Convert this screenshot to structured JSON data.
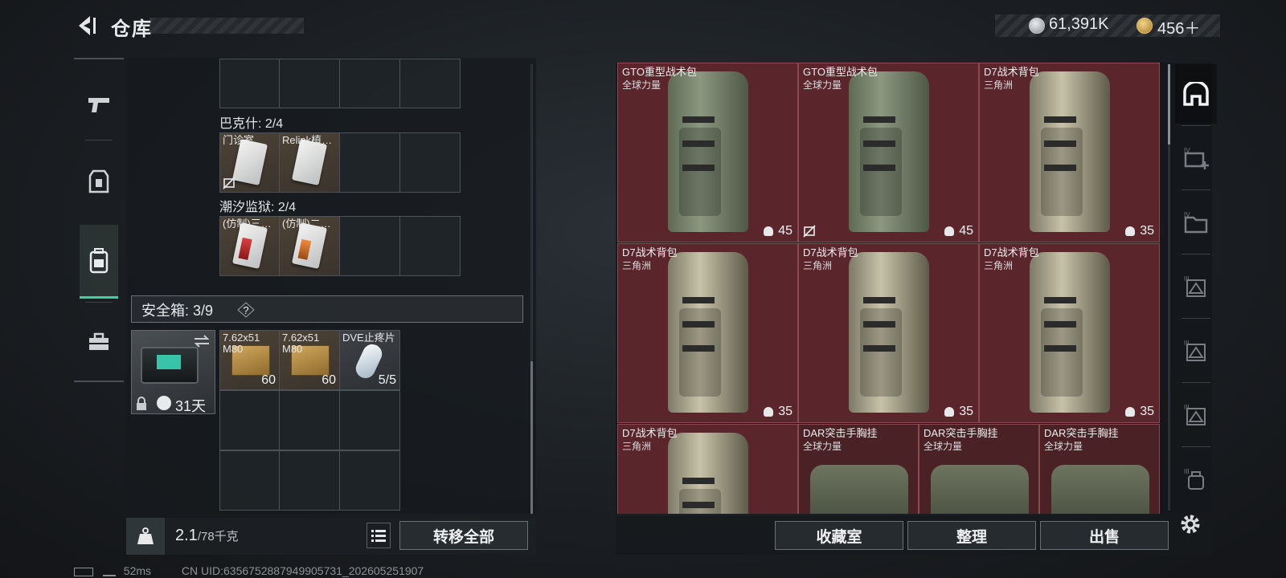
{
  "header": {
    "title": "仓库",
    "coins": "61,391K",
    "gems": "456＋"
  },
  "left_rail": [
    {
      "icon": "pistol-icon",
      "active": false
    },
    {
      "icon": "armor-icon",
      "active": false
    },
    {
      "icon": "backpack-icon",
      "active": true
    },
    {
      "icon": "toolbox-icon",
      "active": false
    }
  ],
  "groups": [
    {
      "label": "巴克什: 2/4",
      "items": [
        {
          "name": "门诊室",
          "locked": true
        },
        {
          "name": "Relink植…"
        }
      ]
    },
    {
      "label": "潮汐监狱: 2/4",
      "items": [
        {
          "name": "(仿制)三…"
        },
        {
          "name": "(仿制)二…"
        }
      ]
    }
  ],
  "safebox": {
    "label": "安全箱: 3/9",
    "help": "?",
    "duration": "31天",
    "items": [
      {
        "name": "7.62x51 M80",
        "qty": "60"
      },
      {
        "name": "7.62x51 M80",
        "qty": "60"
      },
      {
        "name": "DVE止疼片",
        "qty": "5/5"
      }
    ]
  },
  "weight": {
    "current": "2.1",
    "max": "/78千克"
  },
  "transfer_all": "转移全部",
  "footer": {
    "ping": "52ms",
    "uid": "CN UID:6356752887949905731_202605251907"
  },
  "storage": [
    {
      "name": "GTO重型战术包",
      "sub": "全球力量",
      "count": "45",
      "kind": "green"
    },
    {
      "name": "GTO重型战术包",
      "sub": "全球力量",
      "count": "45",
      "kind": "green",
      "locked": true
    },
    {
      "name": "D7战术背包",
      "sub": "三角洲",
      "count": "35",
      "kind": "tan"
    },
    {
      "name": "D7战术背包",
      "sub": "三角洲",
      "count": "35",
      "kind": "tan"
    },
    {
      "name": "D7战术背包",
      "sub": "三角洲",
      "count": "35",
      "kind": "tan"
    },
    {
      "name": "D7战术背包",
      "sub": "三角洲",
      "count": "35",
      "kind": "tan"
    },
    {
      "name": "D7战术背包",
      "sub": "三角洲",
      "count": "",
      "kind": "tan"
    },
    {
      "name": "DAR突击手胸挂",
      "sub": "全球力量",
      "count": "",
      "kind": "vest"
    },
    {
      "name": "DAR突击手胸挂",
      "sub": "全球力量",
      "count": "",
      "kind": "vest"
    },
    {
      "name": "DAR突击手胸挂",
      "sub": "全球力量",
      "count": "",
      "kind": "vest"
    }
  ],
  "actions": {
    "collection": "收藏室",
    "sort": "整理",
    "sell": "出售"
  },
  "right_rail": [
    "safehouse-icon",
    "tier-iv-add-icon",
    "tier-iv-folder-icon",
    "tier-iii-icon",
    "tier-iii-icon",
    "tier-iii-icon",
    "tier-iii-bag-icon"
  ]
}
